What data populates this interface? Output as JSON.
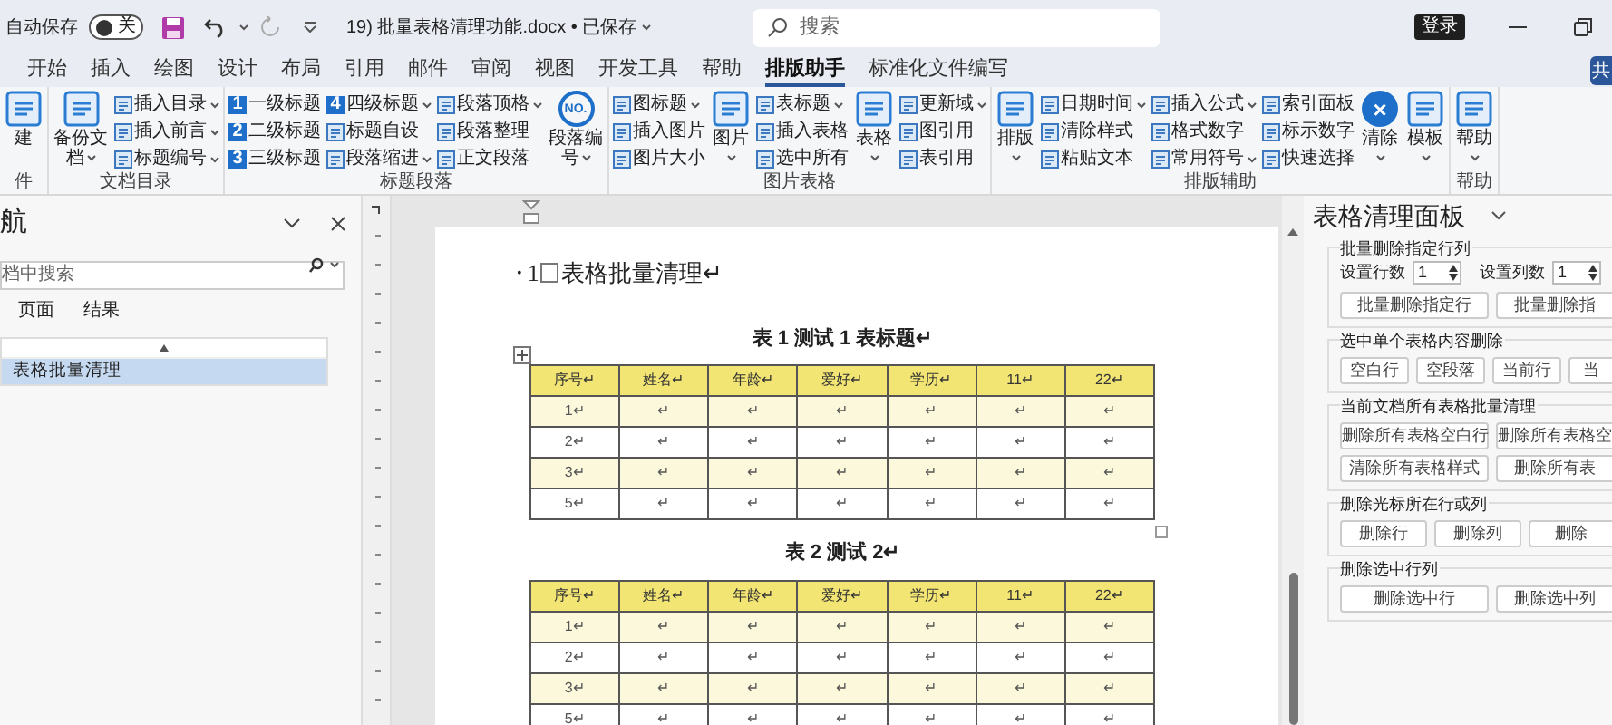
{
  "title_bar": {
    "autosave_label": "自动保存",
    "autosave_toggle": {
      "label": "关",
      "on": false
    },
    "document_title": "19) 批量表格清理功能.docx • 已保存",
    "search": {
      "placeholder": "搜索"
    },
    "sign_in": "登录"
  },
  "menu_tabs": [
    {
      "label": "开始",
      "selected": false
    },
    {
      "label": "插入",
      "selected": false
    },
    {
      "label": "绘图",
      "selected": false
    },
    {
      "label": "设计",
      "selected": false
    },
    {
      "label": "布局",
      "selected": false
    },
    {
      "label": "引用",
      "selected": false
    },
    {
      "label": "邮件",
      "selected": false
    },
    {
      "label": "审阅",
      "selected": false
    },
    {
      "label": "视图",
      "selected": false
    },
    {
      "label": "开发工具",
      "selected": false
    },
    {
      "label": "帮助",
      "selected": false
    },
    {
      "label": "排版助手",
      "selected": true
    },
    {
      "label": "标准化文件编写",
      "selected": false
    }
  ],
  "share_button": "共",
  "ribbon": [
    {
      "label": "件",
      "columns": [
        {
          "kind": "large",
          "label": "建",
          "caret": false
        }
      ]
    },
    {
      "label": "文档目录",
      "columns": [
        {
          "kind": "large",
          "label": "备份文档",
          "caret": true
        },
        {
          "kind": "stack",
          "items": [
            {
              "label": "插入目录",
              "caret": true
            },
            {
              "label": "插入前言",
              "caret": true
            },
            {
              "label": "标题编号",
              "caret": true
            }
          ]
        }
      ]
    },
    {
      "label": "标题段落",
      "columns": [
        {
          "kind": "stack",
          "items": [
            {
              "label": "一级标题",
              "badge": "1",
              "caret": false
            },
            {
              "label": "二级标题",
              "badge": "2",
              "caret": false
            },
            {
              "label": "三级标题",
              "badge": "3",
              "caret": false
            }
          ]
        },
        {
          "kind": "stack",
          "items": [
            {
              "label": "四级标题",
              "badge": "4",
              "caret": true
            },
            {
              "label": "标题自设",
              "caret": false
            },
            {
              "label": "段落缩进",
              "caret": true
            }
          ]
        },
        {
          "kind": "stack",
          "items": [
            {
              "label": "段落顶格",
              "caret": true
            },
            {
              "label": "段落整理",
              "caret": false
            },
            {
              "label": "正文段落",
              "caret": false
            }
          ]
        },
        {
          "kind": "large",
          "label": "段落编号",
          "badge": "NO.",
          "caret": true
        }
      ]
    },
    {
      "label": "图片表格",
      "columns": [
        {
          "kind": "stack",
          "items": [
            {
              "label": "图标题",
              "caret": true
            },
            {
              "label": "插入图片",
              "caret": false
            },
            {
              "label": "图片大小",
              "caret": false
            }
          ]
        },
        {
          "kind": "large",
          "label": "图片",
          "caret": true
        },
        {
          "kind": "stack",
          "items": [
            {
              "label": "表标题",
              "caret": true
            },
            {
              "label": "插入表格",
              "caret": false
            },
            {
              "label": "选中所有",
              "caret": false
            }
          ]
        },
        {
          "kind": "large",
          "label": "表格",
          "caret": true
        },
        {
          "kind": "stack",
          "items": [
            {
              "label": "更新域",
              "caret": true
            },
            {
              "label": "图引用",
              "caret": false
            },
            {
              "label": "表引用",
              "caret": false
            }
          ]
        }
      ]
    },
    {
      "label": "排版辅助",
      "columns": [
        {
          "kind": "large",
          "label": "排版",
          "caret": true
        },
        {
          "kind": "stack",
          "items": [
            {
              "label": "日期时间",
              "caret": true
            },
            {
              "label": "清除样式",
              "caret": false
            },
            {
              "label": "粘贴文本",
              "caret": false
            }
          ]
        },
        {
          "kind": "stack",
          "items": [
            {
              "label": "插入公式",
              "caret": true
            },
            {
              "label": "格式数字",
              "caret": false
            },
            {
              "label": "常用符号",
              "caret": true
            }
          ]
        },
        {
          "kind": "stack",
          "items": [
            {
              "label": "索引面板",
              "caret": false
            },
            {
              "label": "标示数字",
              "caret": false
            },
            {
              "label": "快速选择",
              "caret": false
            }
          ]
        },
        {
          "kind": "large",
          "label": "清除",
          "badge": "×",
          "caret": true
        },
        {
          "kind": "large",
          "label": "模板",
          "caret": true
        }
      ]
    },
    {
      "label": "帮助",
      "columns": [
        {
          "kind": "large",
          "label": "帮助",
          "caret": true
        }
      ]
    }
  ],
  "nav_pane": {
    "title": "航",
    "search": {
      "placeholder": "档中搜索"
    },
    "tabs": [
      {
        "label": "页面",
        "selected": false
      },
      {
        "label": "结果",
        "selected": false
      }
    ],
    "tree": [
      {
        "label": "表格批量清理",
        "selected": true
      }
    ]
  },
  "document": {
    "heading": {
      "bullet": "•",
      "number": "1",
      "text": "表格批量清理↵"
    },
    "tables": [
      {
        "caption": "表 1 测试 1 表标题↵",
        "columns": [
          "序号↵",
          "姓名↵",
          "年龄↵",
          "爱好↵",
          "学历↵",
          "11↵",
          "22↵"
        ],
        "rows": [
          [
            "1↵",
            "↵",
            "↵",
            "↵",
            "↵",
            "↵",
            "↵"
          ],
          [
            "2↵",
            "↵",
            "↵",
            "↵",
            "↵",
            "↵",
            "↵"
          ],
          [
            "3↵",
            "↵",
            "↵",
            "↵",
            "↵",
            "↵",
            "↵"
          ],
          [
            "5↵",
            "↵",
            "↵",
            "↵",
            "↵",
            "↵",
            "↵"
          ]
        ]
      },
      {
        "caption": "表 2 测试 2↵",
        "columns": [
          "序号↵",
          "姓名↵",
          "年龄↵",
          "爱好↵",
          "学历↵",
          "11↵",
          "22↵"
        ],
        "rows": [
          [
            "1↵",
            "↵",
            "↵",
            "↵",
            "↵",
            "↵",
            "↵"
          ],
          [
            "2↵",
            "↵",
            "↵",
            "↵",
            "↵",
            "↵",
            "↵"
          ],
          [
            "3↵",
            "↵",
            "↵",
            "↵",
            "↵",
            "↵",
            "↵"
          ],
          [
            "5↵",
            "↵",
            "↵",
            "↵",
            "↵",
            "↵",
            "↵"
          ]
        ]
      }
    ]
  },
  "panel": {
    "title": "表格清理面板",
    "groups": [
      {
        "title": "批量删除指定行列",
        "fields": [
          {
            "label": "设置行数",
            "value": "1"
          },
          {
            "label": "设置列数",
            "value": "1"
          }
        ],
        "buttons": [
          [
            "批量删除指定行",
            "批量删除指"
          ]
        ]
      },
      {
        "title": "选中单个表格内容删除",
        "buttons": [
          [
            "空白行",
            "空段落",
            "当前行",
            "当"
          ]
        ]
      },
      {
        "title": "当前文档所有表格批量清理",
        "buttons": [
          [
            "删除所有表格空白行",
            "删除所有表格空"
          ],
          [
            "清除所有表格样式",
            "删除所有表"
          ]
        ]
      },
      {
        "title": "删除光标所在行或列",
        "buttons": [
          [
            "删除行",
            "删除列",
            "删除"
          ]
        ]
      },
      {
        "title": "删除选中行列",
        "buttons": [
          [
            "删除选中行",
            "删除选中列"
          ]
        ]
      }
    ]
  }
}
